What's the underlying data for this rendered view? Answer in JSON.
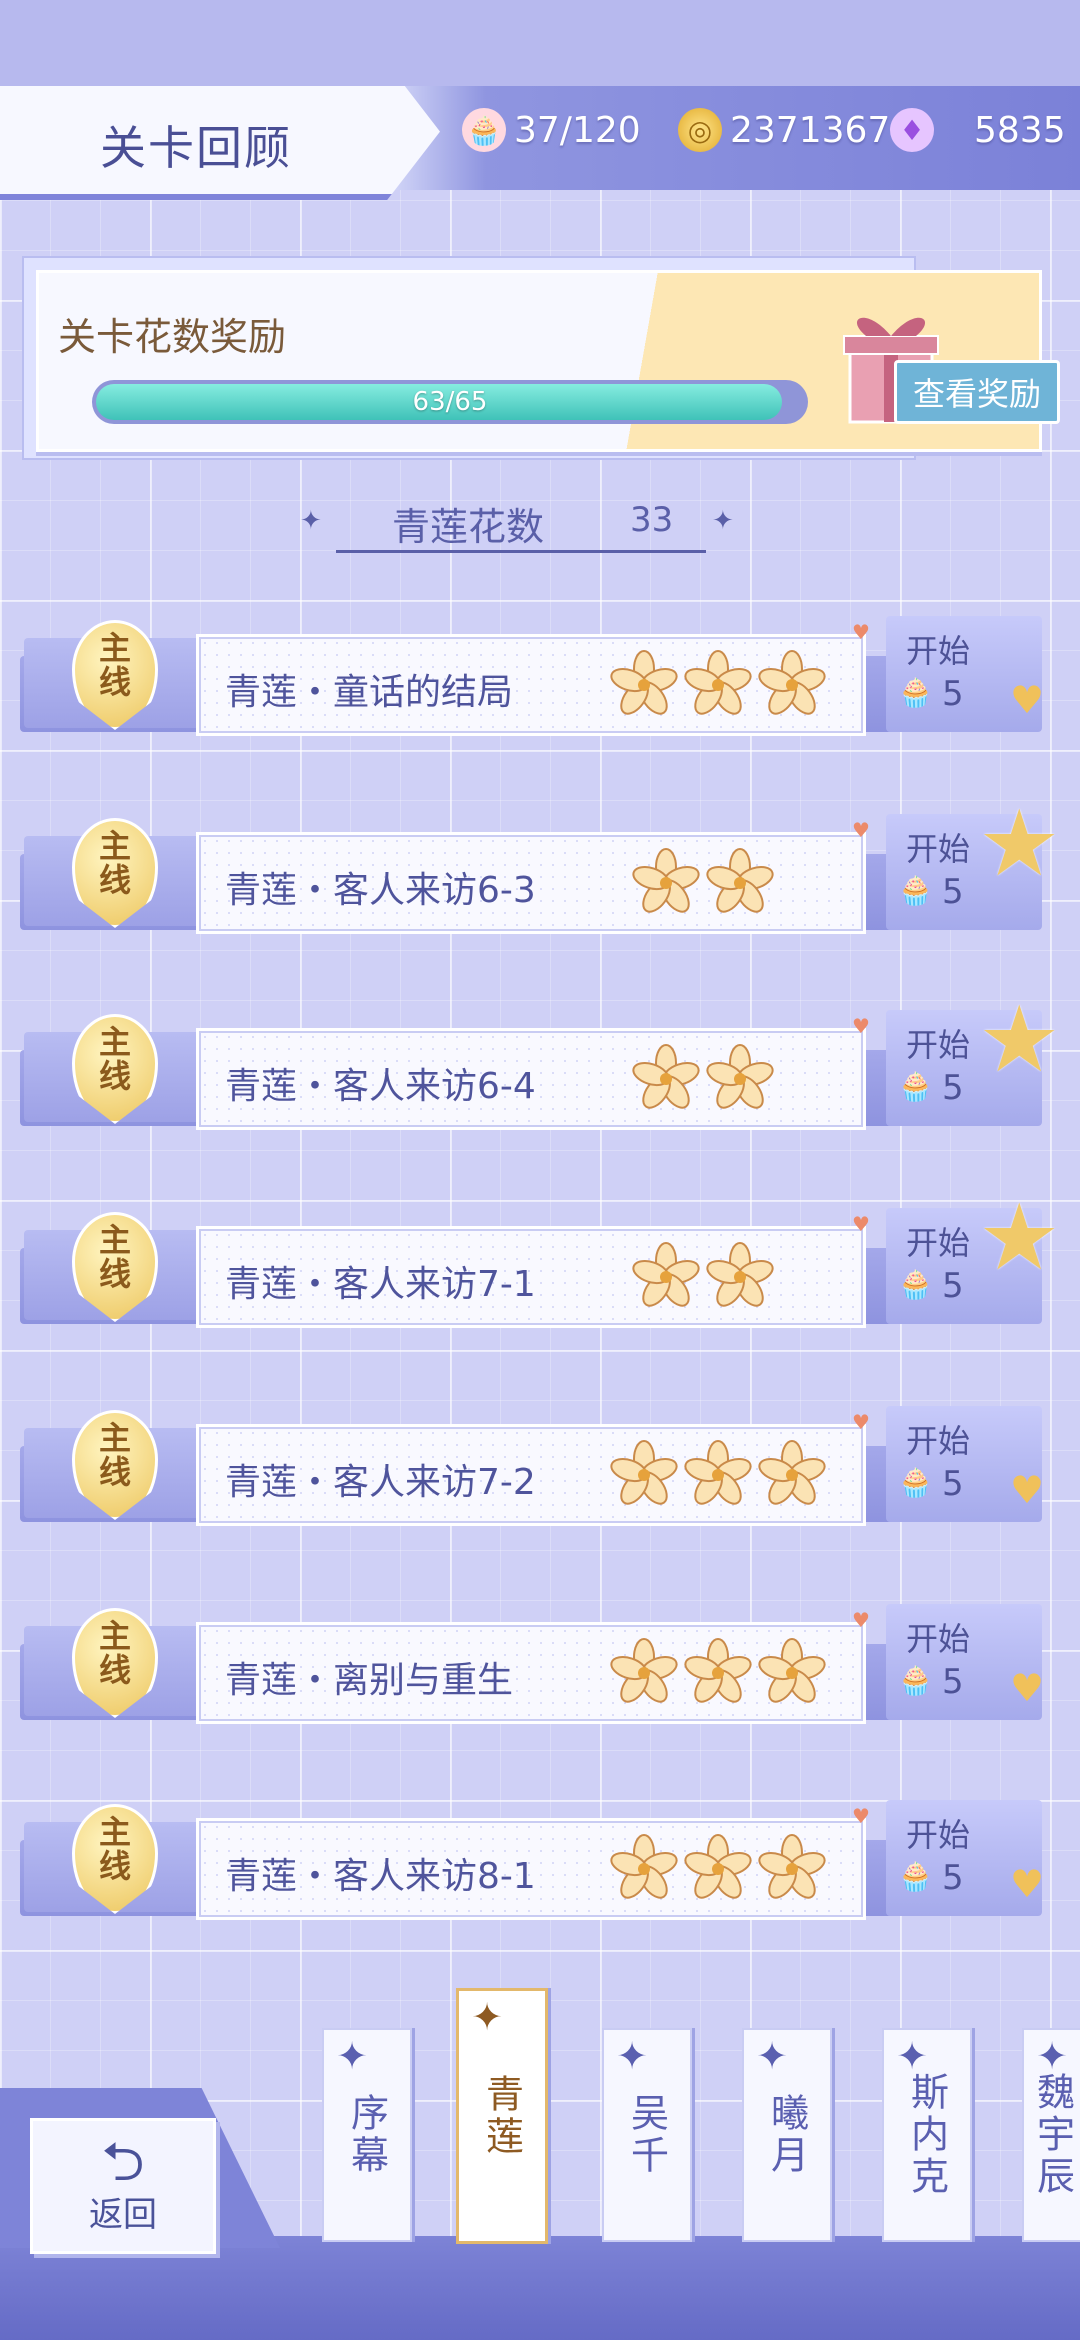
{
  "header": {
    "title": "关卡回顾",
    "resources": [
      {
        "icon": "cake-stamina-icon",
        "value": "37/120"
      },
      {
        "icon": "gold-coin-icon",
        "value": "2371367"
      },
      {
        "icon": "swan-diamond-icon",
        "value": "5835"
      }
    ]
  },
  "reward": {
    "title": "关卡花数奖励",
    "progress_text": "63/65",
    "progress_fraction": 0.969,
    "view_button": "查看奖励"
  },
  "flower_count": {
    "label": "青莲花数",
    "value": "33"
  },
  "levels": [
    {
      "badge": [
        "主",
        "线"
      ],
      "name": "青莲・童话的结局",
      "flowers": 3,
      "start": "开始",
      "cost": "5",
      "swan_star": false
    },
    {
      "badge": [
        "主",
        "线"
      ],
      "name": "青莲・客人来访6-3",
      "flowers": 2,
      "start": "开始",
      "cost": "5",
      "swan_star": true
    },
    {
      "badge": [
        "主",
        "线"
      ],
      "name": "青莲・客人来访6-4",
      "flowers": 2,
      "start": "开始",
      "cost": "5",
      "swan_star": true
    },
    {
      "badge": [
        "主",
        "线"
      ],
      "name": "青莲・客人来访7-1",
      "flowers": 2,
      "start": "开始",
      "cost": "5",
      "swan_star": true
    },
    {
      "badge": [
        "主",
        "线"
      ],
      "name": "青莲・客人来访7-2",
      "flowers": 3,
      "start": "开始",
      "cost": "5",
      "swan_star": false
    },
    {
      "badge": [
        "主",
        "线"
      ],
      "name": "青莲・离别与重生",
      "flowers": 3,
      "start": "开始",
      "cost": "5",
      "swan_star": false
    },
    {
      "badge": [
        "主",
        "线"
      ],
      "name": "青莲・客人来访8-1",
      "flowers": 3,
      "start": "开始",
      "cost": "5",
      "swan_star": false
    }
  ],
  "bottom": {
    "back_label": "返回",
    "tabs": [
      {
        "label": "序幕",
        "active": false
      },
      {
        "label": "青莲",
        "active": true
      },
      {
        "label": "吴千",
        "active": false
      },
      {
        "label": "曦月",
        "active": false
      },
      {
        "label": "斯内克",
        "active": false
      },
      {
        "label": "魏宇辰",
        "active": false
      }
    ]
  },
  "colors": {
    "background": "#cfd0f6",
    "accent": "#7b81d8",
    "progress": "#3fc2b8",
    "gold": "#ecc55d"
  }
}
